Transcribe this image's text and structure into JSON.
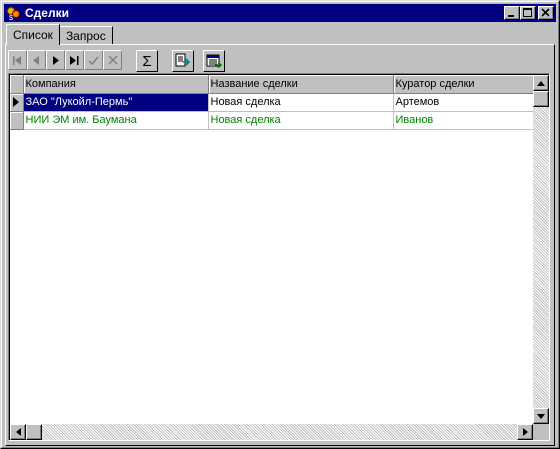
{
  "window": {
    "title": "Сделки",
    "controls": {
      "minimize": "minimize-icon",
      "maximize": "maximize-icon",
      "close": "close-icon"
    }
  },
  "tabs": [
    {
      "label": "Список",
      "active": true
    },
    {
      "label": "Запрос",
      "active": false
    }
  ],
  "toolbar": {
    "nav_buttons": [
      {
        "name": "first-record-icon",
        "glyph": "|◀",
        "enabled": false
      },
      {
        "name": "prior-record-icon",
        "glyph": "◀",
        "enabled": false
      },
      {
        "name": "next-record-icon",
        "glyph": "▶",
        "enabled": true
      },
      {
        "name": "last-record-icon",
        "glyph": "▶|",
        "enabled": true
      },
      {
        "name": "post-checkmark-icon",
        "glyph": "✓",
        "enabled": false
      },
      {
        "name": "cancel-x-icon",
        "glyph": "✕",
        "enabled": false
      }
    ],
    "sum_glyph": "Σ"
  },
  "grid": {
    "columns": [
      "Компания",
      "Название сделки",
      "Куратор сделки"
    ],
    "rows": [
      {
        "company": "ЗАО \"Лукойл-Пермь\"",
        "deal": "Новая сделка",
        "curator": "Артемов",
        "selected": true
      },
      {
        "company": "НИИ ЭМ им. Баумана",
        "deal": "Новая сделка",
        "curator": "Иванов",
        "selected": false
      }
    ]
  },
  "colors": {
    "titlebar": "#000080",
    "selection": "#000080",
    "new_row_text": "#008000",
    "face": "#c0c0c0"
  }
}
